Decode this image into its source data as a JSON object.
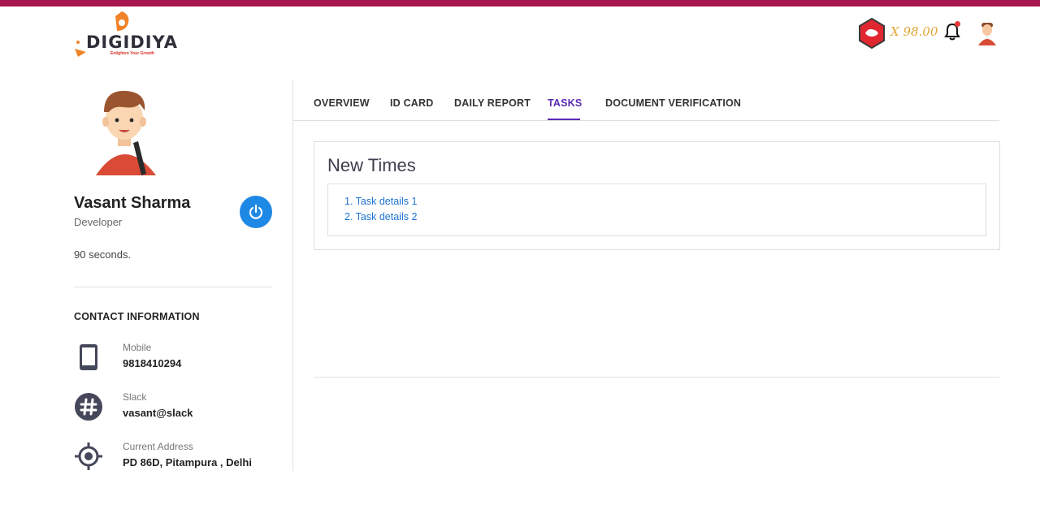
{
  "brand": {
    "name": "DIGIDIYA",
    "tagline": "Enlighten Your Growth",
    "accent_color": "#a8164f"
  },
  "header": {
    "balance": "X 98.00",
    "coin_icon": "hexagon-badge-icon",
    "notification_icon": "bell-icon",
    "avatar_icon": "user-avatar-icon"
  },
  "profile": {
    "name": "Vasant Sharma",
    "role": "Developer",
    "timer": "90 seconds.",
    "power_icon": "power-icon"
  },
  "contact": {
    "title": "CONTACT INFORMATION",
    "items": [
      {
        "label": "Mobile",
        "value": "9818410294",
        "icon": "mobile-phone-icon"
      },
      {
        "label": "Slack",
        "value": "vasant@slack",
        "icon": "slack-hash-icon"
      },
      {
        "label": "Current Address",
        "value": "PD 86D, Pitampura , Delhi",
        "icon": "location-target-icon"
      }
    ]
  },
  "tabs": [
    {
      "label": "OVERVIEW",
      "active": false
    },
    {
      "label": "ID CARD",
      "active": false
    },
    {
      "label": "DAILY REPORT",
      "active": false
    },
    {
      "label": "TASKS",
      "active": true
    },
    {
      "label": "DOCUMENT VERIFICATION",
      "active": false
    }
  ],
  "tasks": {
    "title": "New Times",
    "items": [
      "1. Task details 1",
      "2. Task details 2"
    ]
  }
}
